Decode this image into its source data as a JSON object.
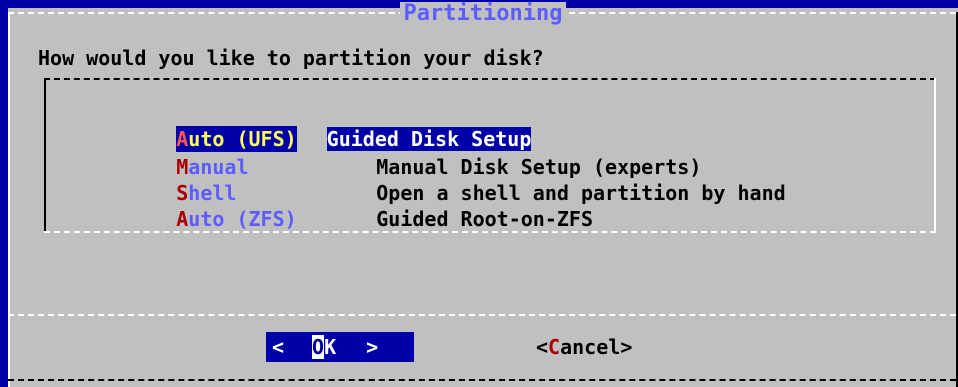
{
  "dialog": {
    "title": "Partitioning",
    "prompt": "How would you like to partition your disk?"
  },
  "menu": {
    "items": [
      {
        "hotkey": "A",
        "tag_rest": "uto (UFS)",
        "description": "Guided Disk Setup",
        "selected": true
      },
      {
        "hotkey": "M",
        "tag_rest": "anual",
        "description": "Manual Disk Setup (experts)",
        "selected": false
      },
      {
        "hotkey": "S",
        "tag_rest": "hell",
        "description": "Open a shell and partition by hand",
        "selected": false
      },
      {
        "hotkey": "A",
        "tag_rest": "uto (ZFS)",
        "description": "Guided Root-on-ZFS",
        "selected": false
      }
    ]
  },
  "buttons": {
    "ok": {
      "left": "<",
      "cursor": "O",
      "rest": "K",
      "right": ">"
    },
    "cancel": {
      "open": "<",
      "hotkey": "C",
      "rest": "ancel",
      "close": ">"
    }
  },
  "colors": {
    "background": "#0000a8",
    "dialog": "#c0c0c0",
    "title": "#5c5cff",
    "hotkey": "#a80000",
    "selected_tag": "#ffff55"
  }
}
